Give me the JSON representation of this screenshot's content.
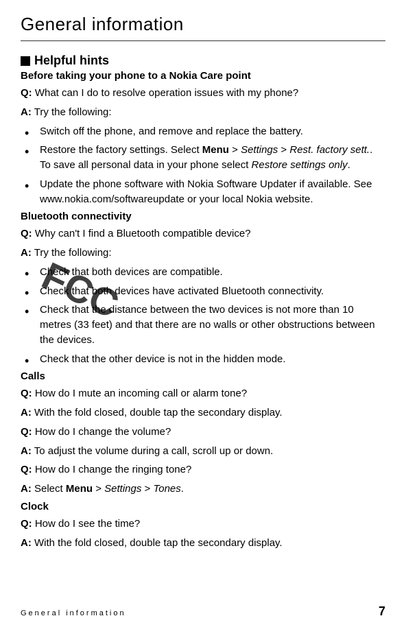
{
  "page": {
    "title": "General information",
    "footer_label": "General information",
    "page_number": "7",
    "watermark": "FCC"
  },
  "section1": {
    "heading": "Helpful hints",
    "sub1": "Before taking your phone to a Nokia Care point",
    "q1_label": "Q:",
    "q1_text": " What can I do to resolve operation issues with my phone?",
    "a1_label": "A:",
    "a1_text": " Try the following:",
    "bullets1": [
      "Switch off the phone, and remove and replace the battery.",
      "Restore the factory settings. Select ",
      "Update the phone software with Nokia Software Updater if available. See www.nokia.com/softwareupdate or your local Nokia website."
    ],
    "b2_menu": "Menu",
    "b2_settings": "Settings",
    "b2_rest": "Rest. factory sett.",
    "b2_cont": ". To save all personal data in your phone select ",
    "b2_restore": "Restore settings only",
    "sub2": "Bluetooth connectivity",
    "q2_label": "Q:",
    "q2_text": " Why can't I find a Bluetooth compatible device?",
    "a2_label": "A:",
    "a2_text": " Try the following:",
    "bullets2": [
      "Check that both devices are compatible.",
      "Check that both devices have activated Bluetooth connectivity.",
      "Check that the distance between the two devices is not more than 10 metres (33 feet) and that there are no walls or other obstructions between the devices.",
      "Check that the other device is not in the hidden mode."
    ],
    "sub3": "Calls",
    "q3_label": "Q:",
    "q3_text": " How do I mute an incoming call or alarm tone?",
    "a3_label": "A:",
    "a3_text": " With the fold closed, double tap the secondary display.",
    "q4_label": "Q:",
    "q4_text": " How do I change the volume?",
    "a4_label": "A:",
    "a4_text": " To adjust the volume during a call, scroll up or down.",
    "q5_label": "Q:",
    "q5_text": " How do I change the ringing tone?",
    "a5_label": "A:",
    "a5_text": " Select ",
    "a5_menu": "Menu",
    "a5_settings": "Settings",
    "a5_tones": "Tones",
    "sub4": "Clock",
    "q6_label": "Q:",
    "q6_text": " How do I see the time?",
    "a6_label": "A:",
    "a6_text": " With the fold closed, double tap the secondary display."
  }
}
